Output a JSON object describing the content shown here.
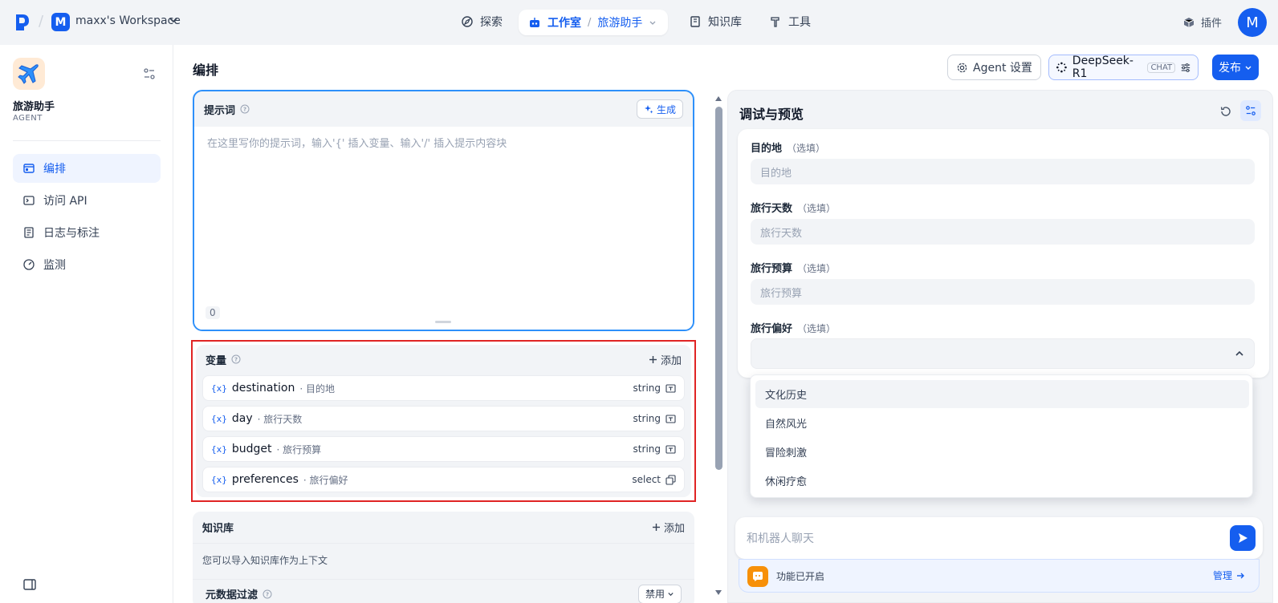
{
  "topbar": {
    "workspace_initial": "M",
    "workspace_name": "maxx's Workspace",
    "nav": {
      "explore": "探索",
      "studio": "工作室",
      "app_name": "旅游助手",
      "knowledge": "知识库",
      "tools": "工具"
    },
    "plugins": "插件",
    "avatar_initial": "M"
  },
  "sidebar": {
    "app_name": "旅游助手",
    "app_type": "AGENT",
    "items": [
      {
        "label": "编排",
        "icon": "layout-icon",
        "active": true
      },
      {
        "label": "访问 API",
        "icon": "terminal-icon",
        "active": false
      },
      {
        "label": "日志与标注",
        "icon": "document-icon",
        "active": false
      },
      {
        "label": "监测",
        "icon": "gauge-icon",
        "active": false
      }
    ]
  },
  "header": {
    "title": "编排",
    "agent_settings": "Agent 设置",
    "model_name": "DeepSeek-R1",
    "model_tag": "CHAT",
    "publish": "发布"
  },
  "prompt": {
    "title": "提示词",
    "generate": "生成",
    "placeholder": "在这里写你的提示词，输入'{' 插入变量、输入'/' 插入提示内容块",
    "char_count": "0"
  },
  "variables": {
    "title": "变量",
    "add": "添加",
    "items": [
      {
        "key": "destination",
        "desc": "· 目的地",
        "type": "string"
      },
      {
        "key": "day",
        "desc": "· 旅行天数",
        "type": "string"
      },
      {
        "key": "budget",
        "desc": "· 旅行预算",
        "type": "string"
      },
      {
        "key": "preferences",
        "desc": "· 旅行偏好",
        "type": "select"
      }
    ]
  },
  "knowledge": {
    "title": "知识库",
    "add": "添加",
    "desc": "您可以导入知识库作为上下文",
    "metadata_filter": "元数据过滤",
    "metadata_value": "禁用"
  },
  "debug": {
    "title": "调试与预览",
    "optional": "（选填）",
    "fields": [
      {
        "label": "目的地",
        "placeholder": "目的地"
      },
      {
        "label": "旅行天数",
        "placeholder": "旅行天数"
      },
      {
        "label": "旅行预算",
        "placeholder": "旅行预算"
      },
      {
        "label": "旅行偏好",
        "placeholder": ""
      }
    ],
    "dropdown_options": [
      "文化历史",
      "自然风光",
      "冒险刺激",
      "休闲疗愈"
    ],
    "chat_placeholder": "和机器人聊天",
    "feature_text": "功能已开启",
    "manage": "管理"
  },
  "colors": {
    "accent": "#155eef",
    "highlight_border": "#e02424",
    "feature_icon": "#f79009"
  }
}
